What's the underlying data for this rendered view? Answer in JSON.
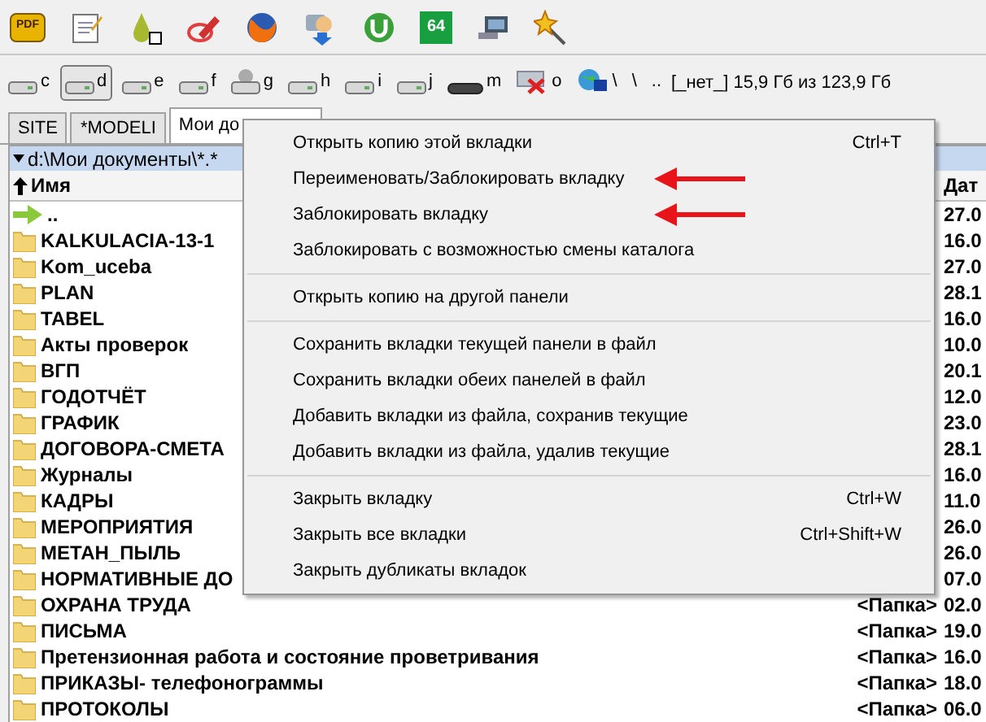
{
  "toolbar": [
    {
      "kind": "pdf",
      "label": "PDF"
    },
    {
      "kind": "notepad"
    },
    {
      "kind": "drop"
    },
    {
      "kind": "pencil"
    },
    {
      "kind": "firefox"
    },
    {
      "kind": "download"
    },
    {
      "kind": "torrent"
    },
    {
      "kind": "app64",
      "label": "64"
    },
    {
      "kind": "monitor"
    },
    {
      "kind": "wand"
    }
  ],
  "drives": [
    {
      "kind": "drive",
      "letter": "c",
      "selected": false
    },
    {
      "kind": "drive",
      "letter": "d",
      "selected": true
    },
    {
      "kind": "drive",
      "letter": "e",
      "selected": false
    },
    {
      "kind": "drive",
      "letter": "f",
      "selected": false
    },
    {
      "kind": "netdrive",
      "letter": "g",
      "selected": false
    },
    {
      "kind": "drive",
      "letter": "h",
      "selected": false
    },
    {
      "kind": "drive",
      "letter": "i",
      "selected": false
    },
    {
      "kind": "drive",
      "letter": "j",
      "selected": false
    },
    {
      "kind": "flat",
      "letter": "m",
      "selected": false
    },
    {
      "kind": "offline",
      "letter": "o",
      "selected": false
    },
    {
      "kind": "network",
      "letter": "\\",
      "selected": false
    },
    {
      "kind": "plain",
      "letter": "\\",
      "selected": false
    },
    {
      "kind": "plain",
      "letter": "..",
      "selected": false
    }
  ],
  "volume_label": "[_нет_]",
  "free_space": "15,9 Гб из 123,9 Гб",
  "tabs": [
    {
      "label": "SITE",
      "selected": false
    },
    {
      "label": "*MODELI",
      "selected": false
    },
    {
      "label": "Мои до",
      "selected": true
    }
  ],
  "path": "d:\\Мои документы\\*.*",
  "columns": [
    "Имя",
    "Дат"
  ],
  "rows": [
    {
      "kind": "up",
      "name": "..",
      "size": "",
      "date": "27.0"
    },
    {
      "kind": "folder",
      "name": "KALKULACIA-13-1",
      "size": "",
      "date": "16.0"
    },
    {
      "kind": "folder",
      "name": "Kom_uceba",
      "size": "",
      "date": "27.0"
    },
    {
      "kind": "folder",
      "name": "PLAN",
      "size": "",
      "date": "28.1"
    },
    {
      "kind": "folder",
      "name": "TABEL",
      "size": "",
      "date": "16.0"
    },
    {
      "kind": "folder",
      "name": "Акты проверок",
      "size": "",
      "date": "10.0"
    },
    {
      "kind": "folder",
      "name": "ВГП",
      "size": "",
      "date": "20.1"
    },
    {
      "kind": "folder",
      "name": "ГОДОТЧЁТ",
      "size": "",
      "date": "12.0"
    },
    {
      "kind": "folder",
      "name": "ГРАФИК",
      "size": "",
      "date": "23.0"
    },
    {
      "kind": "folder",
      "name": "ДОГОВОРА-СМЕТА",
      "size": "",
      "date": "28.1"
    },
    {
      "kind": "folder",
      "name": "Журналы",
      "size": "",
      "date": "16.0"
    },
    {
      "kind": "folder",
      "name": "КАДРЫ",
      "size": "",
      "date": "11.0"
    },
    {
      "kind": "folder",
      "name": "МЕРОПРИЯТИЯ",
      "size": "",
      "date": "26.0"
    },
    {
      "kind": "folder",
      "name": "МЕТАН_ПЫЛЬ",
      "size": "",
      "date": "26.0"
    },
    {
      "kind": "folder",
      "name": "НОРМАТИВНЫЕ ДО",
      "size": "",
      "date": "07.0"
    },
    {
      "kind": "folder",
      "name": "ОХРАНА ТРУДА",
      "size": "<Папка>",
      "date": "02.0"
    },
    {
      "kind": "folder",
      "name": "ПИСЬМА",
      "size": "<Папка>",
      "date": "19.0"
    },
    {
      "kind": "folder",
      "name": "Претензионная работа и состояние проветривания",
      "size": "<Папка>",
      "date": "16.0"
    },
    {
      "kind": "folder",
      "name": "ПРИКАЗЫ- телефонограммы",
      "size": "<Папка>",
      "date": "18.0"
    },
    {
      "kind": "folder",
      "name": "ПРОТОКОЛЫ",
      "size": "<Папка>",
      "date": "06.0"
    }
  ],
  "context_menu": [
    {
      "kind": "item",
      "label": "Открыть копию этой вкладки",
      "shortcut": "Ctrl+T",
      "marked": false
    },
    {
      "kind": "item",
      "label": "Переименовать/Заблокировать вкладку",
      "marked": true
    },
    {
      "kind": "item",
      "label": "Заблокировать вкладку",
      "marked": true
    },
    {
      "kind": "item",
      "label": "Заблокировать с возможностью смены каталога",
      "marked": false
    },
    {
      "kind": "separator"
    },
    {
      "kind": "item",
      "label": "Открыть копию на другой панели",
      "marked": false
    },
    {
      "kind": "separator"
    },
    {
      "kind": "item",
      "label": "Сохранить вкладки текущей панели в файл",
      "marked": false
    },
    {
      "kind": "item",
      "label": "Сохранить вкладки обеих панелей в файл",
      "marked": false
    },
    {
      "kind": "item",
      "label": "Добавить вкладки из файла, сохранив текущие",
      "marked": false
    },
    {
      "kind": "item",
      "label": "Добавить вкладки из файла, удалив текущие",
      "marked": false
    },
    {
      "kind": "separator"
    },
    {
      "kind": "item",
      "label": "Закрыть вкладку",
      "shortcut": "Ctrl+W",
      "marked": false
    },
    {
      "kind": "item",
      "label": "Закрыть все вкладки",
      "shortcut": "Ctrl+Shift+W",
      "marked": false
    },
    {
      "kind": "item",
      "label": "Закрыть дубликаты вкладок",
      "marked": false
    }
  ]
}
